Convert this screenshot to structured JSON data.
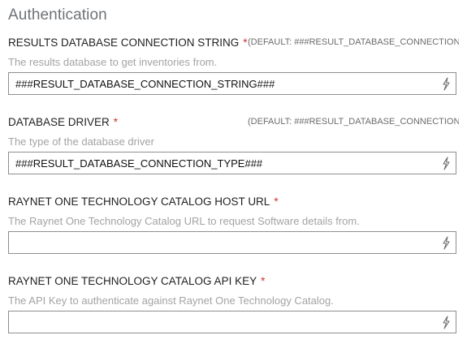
{
  "section": {
    "title": "Authentication"
  },
  "fields": [
    {
      "label": "RESULTS DATABASE CONNECTION STRING",
      "required_mark": "*",
      "default_text": "(DEFAULT: ###RESULT_DATABASE_CONNECTION...",
      "description": "The results database to get inventories from.",
      "value": "###RESULT_DATABASE_CONNECTION_STRING###",
      "icon": "bolt-icon"
    },
    {
      "label": "DATABASE DRIVER",
      "required_mark": "*",
      "default_text": "(DEFAULT: ###RESULT_DATABASE_CONNECTION...",
      "description": "The type of the database driver",
      "value": "###RESULT_DATABASE_CONNECTION_TYPE###",
      "icon": "bolt-icon"
    },
    {
      "label": "RAYNET ONE TECHNOLOGY CATALOG HOST URL",
      "required_mark": "*",
      "description": "The Raynet One Technology Catalog URL to request Software details from.",
      "value": "",
      "icon": "bolt-icon"
    },
    {
      "label": "RAYNET ONE TECHNOLOGY CATALOG API KEY",
      "required_mark": "*",
      "description": "The API Key to authenticate against Raynet One Technology Catalog.",
      "value": "",
      "icon": "bolt-icon"
    }
  ],
  "colors": {
    "required": "#d0312d",
    "title": "#6f7377",
    "description": "#a3a3a3",
    "border": "#8f8f8f"
  }
}
